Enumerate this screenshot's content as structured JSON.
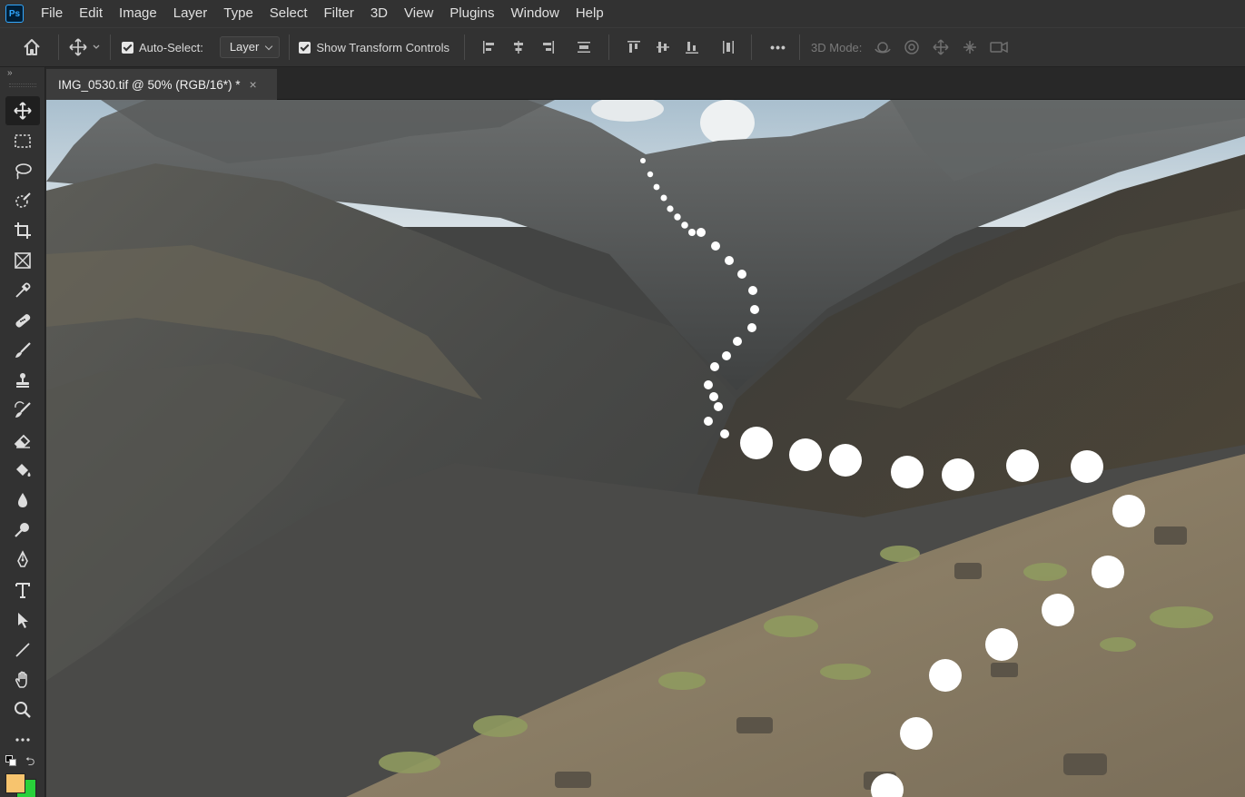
{
  "app": {
    "logo_text": "Ps"
  },
  "menu": [
    "File",
    "Edit",
    "Image",
    "Layer",
    "Type",
    "Select",
    "Filter",
    "3D",
    "View",
    "Plugins",
    "Window",
    "Help"
  ],
  "options": {
    "auto_select_label": "Auto-Select:",
    "auto_select_checked": true,
    "auto_select_target": "Layer",
    "show_transform_label": "Show Transform Controls",
    "show_transform_checked": true,
    "more_label": "•••",
    "mode_3d_label": "3D Mode:"
  },
  "document": {
    "tab_title": "IMG_0530.tif @ 50% (RGB/16*) *",
    "close_glyph": "×"
  },
  "tools": [
    {
      "name": "move-tool",
      "active": true
    },
    {
      "name": "rectangular-marquee-tool"
    },
    {
      "name": "lasso-tool"
    },
    {
      "name": "object-selection-tool"
    },
    {
      "name": "crop-tool"
    },
    {
      "name": "frame-tool"
    },
    {
      "name": "eyedropper-tool"
    },
    {
      "name": "spot-healing-brush-tool"
    },
    {
      "name": "brush-tool"
    },
    {
      "name": "clone-stamp-tool"
    },
    {
      "name": "history-brush-tool"
    },
    {
      "name": "eraser-tool"
    },
    {
      "name": "paint-bucket-tool"
    },
    {
      "name": "blur-tool"
    },
    {
      "name": "dodge-tool"
    },
    {
      "name": "pen-tool"
    },
    {
      "name": "type-tool"
    },
    {
      "name": "path-selection-tool"
    },
    {
      "name": "line-tool"
    },
    {
      "name": "hand-tool"
    },
    {
      "name": "zoom-tool"
    },
    {
      "name": "edit-toolbar"
    }
  ],
  "colors": {
    "foreground": "#f7c46e",
    "background": "#29d13a",
    "accent": "#31a8ff"
  },
  "toolbar_collapse_glyph": "»",
  "swap_glyph": "⮌"
}
